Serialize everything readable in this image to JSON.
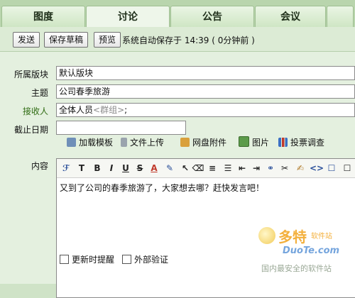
{
  "tabs": [
    "图度",
    "讨论",
    "公告",
    "会议"
  ],
  "toolbar": {
    "send_label": "发送",
    "save_draft_label": "保存草稿",
    "preview_label": "预览",
    "autosave_text": "系统自动保存于 14:39 ( 0分钟前 )"
  },
  "form": {
    "board_label": "所属版块",
    "board_value": "默认版块",
    "subject_label": "主题",
    "subject_value": "公司春季旅游",
    "recipient_label": "接收人",
    "recipient_value": "全体人员",
    "recipient_group_placeholder": "<群组>",
    "recipient_suffix": ";",
    "deadline_label": "截止日期",
    "deadline_value": "",
    "content_label": "内容"
  },
  "attachments": {
    "template": "加载模板",
    "file_upload": "文件上传",
    "netdisk": "网盘附件",
    "image": "图片",
    "poll": "投票调查"
  },
  "editor": {
    "body_text": "又到了公司的春季旅游了，大家想去哪？赶快发言吧！"
  },
  "options": {
    "notify_on_update": "更新时提醒",
    "external_verify": "外部验证"
  },
  "watermark": {
    "brand": "多特",
    "brand_sub": "软件站",
    "url": "DuoTe.com",
    "slogan": "国内最安全的软件站"
  },
  "colors": {
    "background": "#cfe3c7",
    "label_green": "#2f6b12"
  }
}
